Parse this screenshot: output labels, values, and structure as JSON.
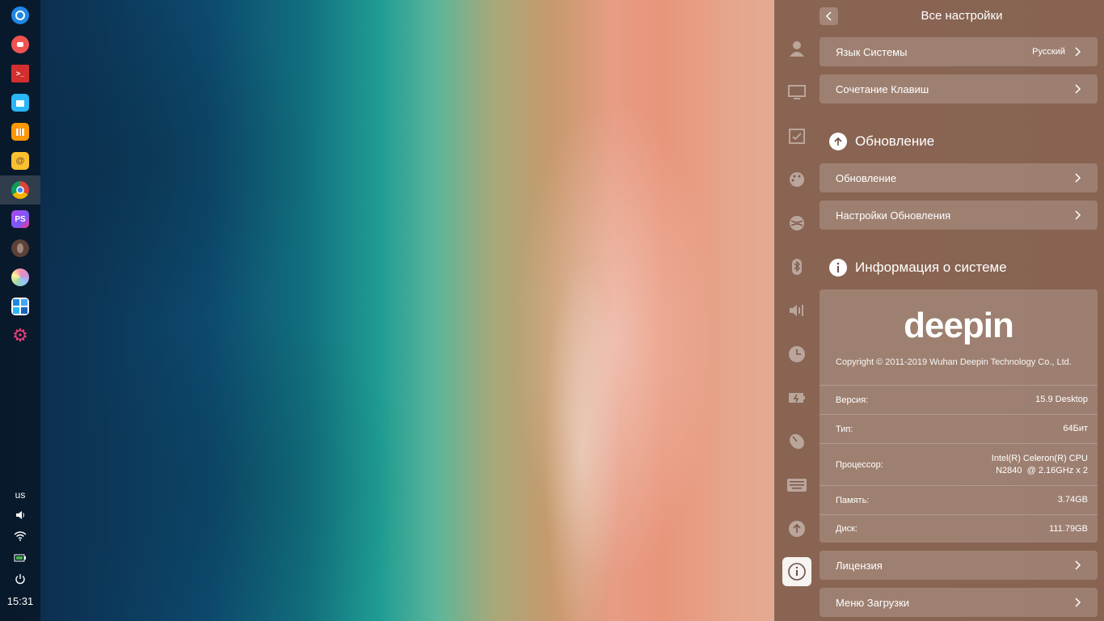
{
  "dock": {
    "apps": [
      {
        "name": "launcher",
        "color": "#1e88e5",
        "glyph": "◒"
      },
      {
        "name": "screen-recorder",
        "color": "#ef5350",
        "glyph": "●"
      },
      {
        "name": "terminal",
        "color": "#d32f2f",
        "glyph": ">_"
      },
      {
        "name": "app-store",
        "color": "#29b6f6",
        "glyph": "▣"
      },
      {
        "name": "archive-manager",
        "color": "#ff9800",
        "glyph": "▥"
      },
      {
        "name": "mail",
        "color": "#fbc02d",
        "glyph": "@"
      },
      {
        "name": "chrome",
        "color": "#ffffff",
        "glyph": "◉"
      },
      {
        "name": "phpstorm",
        "color": "#7e57c2",
        "glyph": "PS"
      },
      {
        "name": "gimp",
        "color": "#5d4037",
        "glyph": "✎"
      },
      {
        "name": "color-picker",
        "color": "#f8bbd0",
        "glyph": "◐"
      },
      {
        "name": "mosaic-app",
        "color": "#1e88e5",
        "glyph": "▦"
      },
      {
        "name": "settings",
        "color": "#ec407a",
        "glyph": "⚙"
      }
    ],
    "tray": {
      "keyboard_layout": "us",
      "volume_icon": "🔈",
      "wifi_icon": "wifi",
      "battery_icon": "battery",
      "power_icon": "⏻",
      "clock": "15:31"
    }
  },
  "panel": {
    "title": "Все настройки",
    "rows_top": [
      {
        "label": "Язык Системы",
        "value": "Русский"
      },
      {
        "label": "Сочетание Клавиш",
        "value": ""
      }
    ],
    "update_section": {
      "header": "Обновление",
      "rows": [
        {
          "label": "Обновление"
        },
        {
          "label": "Настройки Обновления"
        }
      ]
    },
    "info_section": {
      "header": "Информация о системе",
      "logo": "deepin",
      "copyright": "Copyright © 2011-2019 Wuhan Deepin Technology Co., Ltd.",
      "rows": [
        {
          "label": "Версия:",
          "value": "15.9 Desktop"
        },
        {
          "label": "Тип:",
          "value": "64Бит"
        },
        {
          "label": "Процессор:",
          "value": "Intel(R) Celeron(R) CPU",
          "value2": "N2840  @ 2.16GHz x 2"
        },
        {
          "label": "Память:",
          "value": "3.74GB"
        },
        {
          "label": "Диск:",
          "value": "111.79GB"
        }
      ]
    },
    "rows_bottom": [
      {
        "label": "Лицензия"
      },
      {
        "label": "Меню Загрузки"
      }
    ],
    "nav_icons": [
      "account",
      "display",
      "default-apps",
      "personalization",
      "network",
      "bluetooth",
      "sound",
      "datetime",
      "power",
      "mouse",
      "keyboard",
      "update",
      "system-info"
    ]
  }
}
